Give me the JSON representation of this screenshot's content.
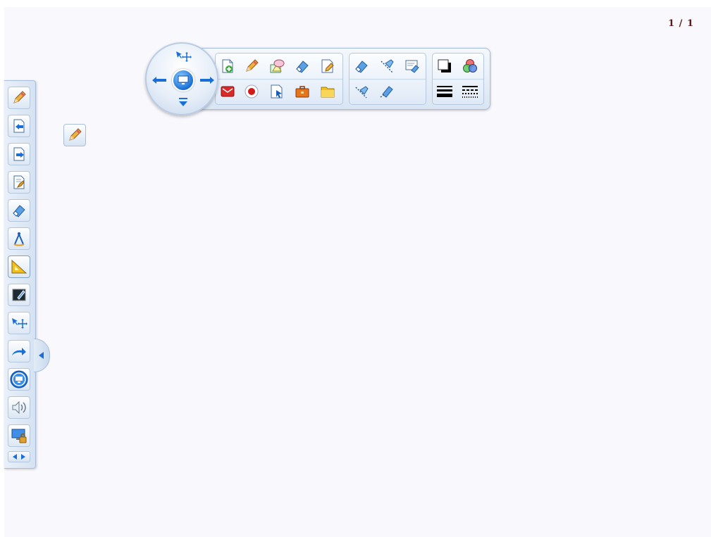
{
  "page_counter": "1 / 1",
  "floating_toolbar": {
    "nav_wheel": {
      "center_icon": "screen-icon",
      "arrows": [
        "select-move-icon",
        "arrow-left-icon",
        "arrow-right-icon",
        "arrow-down-icon"
      ]
    },
    "row1": [
      "new-page-icon",
      "pencil-icon",
      "shape-icon",
      "eraser-icon",
      "edit-page-icon"
    ],
    "row2": [
      "presentation-icon",
      "record-icon",
      "select-page-icon",
      "toolbox-icon",
      "folder-icon"
    ],
    "group2_row1": [
      "eraser-icon",
      "clear-icon",
      "whiteboard-eraser-icon"
    ],
    "group2_row2": [
      "clear-selection-icon",
      "area-eraser-icon"
    ],
    "group3_row1": [
      "color-fill-icon",
      "color-palette-icon"
    ],
    "group3_row2": [
      "line-width-icon",
      "line-style-icon"
    ]
  },
  "sidebar": {
    "items": [
      "pencil-icon",
      "page-back-icon",
      "page-forward-icon",
      "page-clear-icon",
      "eraser-icon",
      "compass-icon",
      "triangle-ruler-icon",
      "blackboard-icon",
      "select-move-icon",
      "redo-arrow-icon",
      "screen-icon",
      "speaker-icon",
      "screen-lock-icon"
    ]
  },
  "current_tool_icon": "pencil-icon",
  "colors": {
    "canvas": "#f8f8fd",
    "accent_blue": "#1a6fd6",
    "page_counter": "#5a1a1a"
  }
}
